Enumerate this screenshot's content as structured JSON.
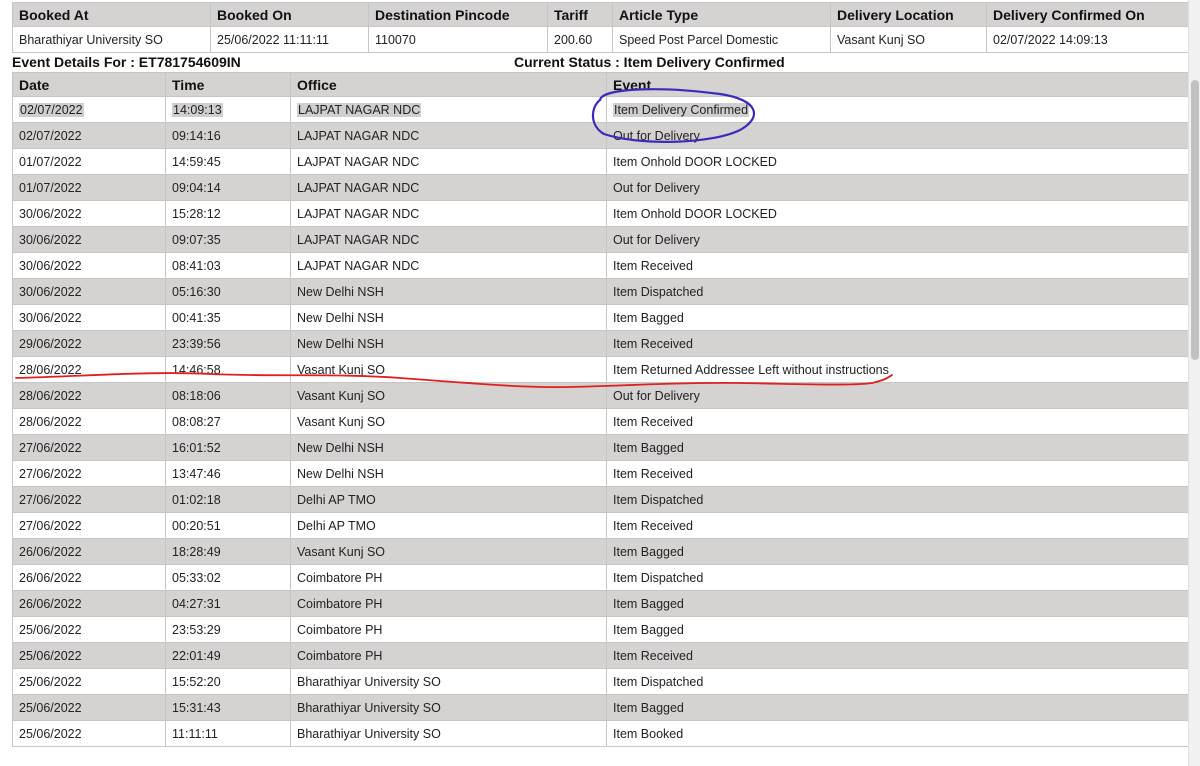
{
  "summary": {
    "headers": [
      "Booked At",
      "Booked On",
      "Destination Pincode",
      "Tariff",
      "Article Type",
      "Delivery Location",
      "Delivery Confirmed On"
    ],
    "values": [
      "Bharathiyar University SO",
      "25/06/2022 11:11:11",
      "110070",
      "200.60",
      "Speed Post Parcel Domestic",
      "Vasant Kunj SO",
      "02/07/2022 14:09:13"
    ]
  },
  "info": {
    "event_details": "Event Details For : ET781754609IN",
    "current_status": "Current Status : Item Delivery Confirmed"
  },
  "events": {
    "headers": [
      "Date",
      "Time",
      "Office",
      "Event"
    ],
    "rows": [
      [
        "02/07/2022",
        "14:09:13",
        "LAJPAT NAGAR NDC",
        "Item Delivery Confirmed"
      ],
      [
        "02/07/2022",
        "09:14:16",
        "LAJPAT NAGAR NDC",
        "Out for Delivery"
      ],
      [
        "01/07/2022",
        "14:59:45",
        "LAJPAT NAGAR NDC",
        "Item Onhold DOOR LOCKED"
      ],
      [
        "01/07/2022",
        "09:04:14",
        "LAJPAT NAGAR NDC",
        "Out for Delivery"
      ],
      [
        "30/06/2022",
        "15:28:12",
        "LAJPAT NAGAR NDC",
        "Item Onhold DOOR LOCKED"
      ],
      [
        "30/06/2022",
        "09:07:35",
        "LAJPAT NAGAR NDC",
        "Out for Delivery"
      ],
      [
        "30/06/2022",
        "08:41:03",
        "LAJPAT NAGAR NDC",
        "Item Received"
      ],
      [
        "30/06/2022",
        "05:16:30",
        "New Delhi NSH",
        "Item Dispatched"
      ],
      [
        "30/06/2022",
        "00:41:35",
        "New Delhi NSH",
        "Item Bagged"
      ],
      [
        "29/06/2022",
        "23:39:56",
        "New Delhi NSH",
        "Item Received"
      ],
      [
        "28/06/2022",
        "14:46:58",
        "Vasant Kunj SO",
        "Item Returned Addressee Left without instructions"
      ],
      [
        "28/06/2022",
        "08:18:06",
        "Vasant Kunj SO",
        "Out for Delivery"
      ],
      [
        "28/06/2022",
        "08:08:27",
        "Vasant Kunj SO",
        "Item Received"
      ],
      [
        "27/06/2022",
        "16:01:52",
        "New Delhi NSH",
        "Item Bagged"
      ],
      [
        "27/06/2022",
        "13:47:46",
        "New Delhi NSH",
        "Item Received"
      ],
      [
        "27/06/2022",
        "01:02:18",
        "Delhi AP TMO",
        "Item Dispatched"
      ],
      [
        "27/06/2022",
        "00:20:51",
        "Delhi AP TMO",
        "Item Received"
      ],
      [
        "26/06/2022",
        "18:28:49",
        "Vasant Kunj SO",
        "Item Bagged"
      ],
      [
        "26/06/2022",
        "05:33:02",
        "Coimbatore PH",
        "Item Dispatched"
      ],
      [
        "26/06/2022",
        "04:27:31",
        "Coimbatore PH",
        "Item Bagged"
      ],
      [
        "25/06/2022",
        "23:53:29",
        "Coimbatore PH",
        "Item Bagged"
      ],
      [
        "25/06/2022",
        "22:01:49",
        "Coimbatore PH",
        "Item Received"
      ],
      [
        "25/06/2022",
        "15:52:20",
        "Bharathiyar University SO",
        "Item Dispatched"
      ],
      [
        "25/06/2022",
        "15:31:43",
        "Bharathiyar University SO",
        "Item Bagged"
      ],
      [
        "25/06/2022",
        "11:11:11",
        "Bharathiyar University SO",
        "Item Booked"
      ]
    ]
  },
  "colors": {
    "header_bg": "#d5d2d2",
    "stripe_bg": "#d5d2d2",
    "circle_annotation": "#3a2bb8",
    "underline_annotation": "#e02020"
  }
}
